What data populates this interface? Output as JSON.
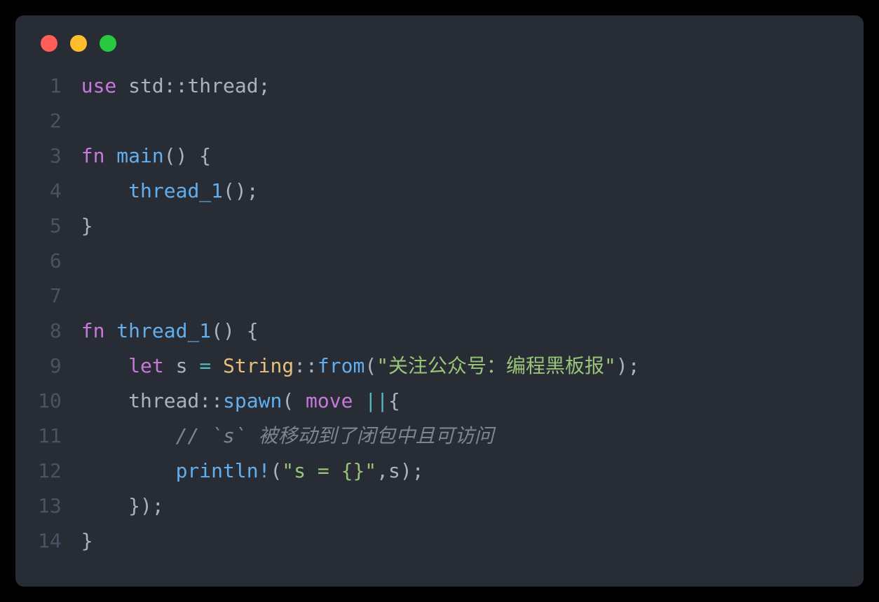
{
  "window": {
    "traffic_lights": [
      "red",
      "yellow",
      "green"
    ]
  },
  "code": {
    "line_numbers": [
      "1",
      "2",
      "3",
      "4",
      "5",
      "6",
      "7",
      "8",
      "9",
      "10",
      "11",
      "12",
      "13",
      "14"
    ],
    "lines": [
      [
        {
          "cls": "tok-keyword",
          "t": "use"
        },
        {
          "cls": "tok-ident",
          "t": " std"
        },
        {
          "cls": "tok-punct",
          "t": "::"
        },
        {
          "cls": "tok-ident",
          "t": "thread"
        },
        {
          "cls": "tok-punct",
          "t": ";"
        }
      ],
      [],
      [
        {
          "cls": "tok-keyword",
          "t": "fn"
        },
        {
          "cls": "tok-ident",
          "t": " "
        },
        {
          "cls": "tok-func",
          "t": "main"
        },
        {
          "cls": "tok-punct",
          "t": "() {"
        }
      ],
      [
        {
          "cls": "tok-ident",
          "t": "    "
        },
        {
          "cls": "tok-func",
          "t": "thread_1"
        },
        {
          "cls": "tok-punct",
          "t": "();"
        }
      ],
      [
        {
          "cls": "tok-punct",
          "t": "}"
        }
      ],
      [],
      [],
      [
        {
          "cls": "tok-keyword",
          "t": "fn"
        },
        {
          "cls": "tok-ident",
          "t": " "
        },
        {
          "cls": "tok-func",
          "t": "thread_1"
        },
        {
          "cls": "tok-punct",
          "t": "() {"
        }
      ],
      [
        {
          "cls": "tok-ident",
          "t": "    "
        },
        {
          "cls": "tok-keyword",
          "t": "let"
        },
        {
          "cls": "tok-ident",
          "t": " s "
        },
        {
          "cls": "tok-op",
          "t": "="
        },
        {
          "cls": "tok-ident",
          "t": " "
        },
        {
          "cls": "tok-type",
          "t": "String"
        },
        {
          "cls": "tok-punct",
          "t": "::"
        },
        {
          "cls": "tok-func",
          "t": "from"
        },
        {
          "cls": "tok-punct",
          "t": "("
        },
        {
          "cls": "tok-string",
          "t": "\"关注公众号：编程黑板报\""
        },
        {
          "cls": "tok-punct",
          "t": ");"
        }
      ],
      [
        {
          "cls": "tok-ident",
          "t": "    thread"
        },
        {
          "cls": "tok-punct",
          "t": "::"
        },
        {
          "cls": "tok-func",
          "t": "spawn"
        },
        {
          "cls": "tok-punct",
          "t": "( "
        },
        {
          "cls": "tok-keyword",
          "t": "move"
        },
        {
          "cls": "tok-punct",
          "t": " "
        },
        {
          "cls": "tok-op",
          "t": "||"
        },
        {
          "cls": "tok-punct",
          "t": "{"
        }
      ],
      [
        {
          "cls": "tok-ident",
          "t": "        "
        },
        {
          "cls": "tok-comment",
          "t": "// `s` 被移动到了闭包中且可访问"
        }
      ],
      [
        {
          "cls": "tok-ident",
          "t": "        "
        },
        {
          "cls": "tok-func",
          "t": "println!"
        },
        {
          "cls": "tok-punct",
          "t": "("
        },
        {
          "cls": "tok-string",
          "t": "\"s = {}\""
        },
        {
          "cls": "tok-punct",
          "t": ",s);"
        }
      ],
      [
        {
          "cls": "tok-ident",
          "t": "    "
        },
        {
          "cls": "tok-punct",
          "t": "});"
        }
      ],
      [
        {
          "cls": "tok-punct",
          "t": "}"
        }
      ]
    ]
  }
}
